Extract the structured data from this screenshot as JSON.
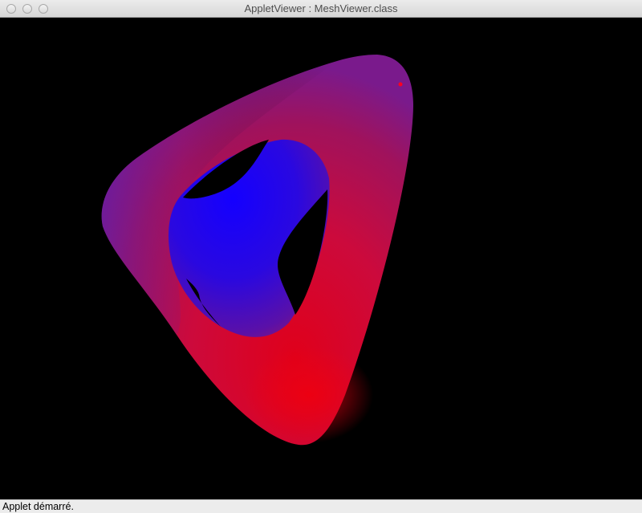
{
  "window": {
    "title": "AppletViewer : MeshViewer.class"
  },
  "viewport": {
    "background_color": "#000000",
    "mesh": {
      "object": "torus-like triangular mesh",
      "outer_color": "#e0002a",
      "inner_color": "#1a00ff",
      "shading": "red-to-blue gradient"
    }
  },
  "status_bar": {
    "text": "Applet démarré."
  }
}
